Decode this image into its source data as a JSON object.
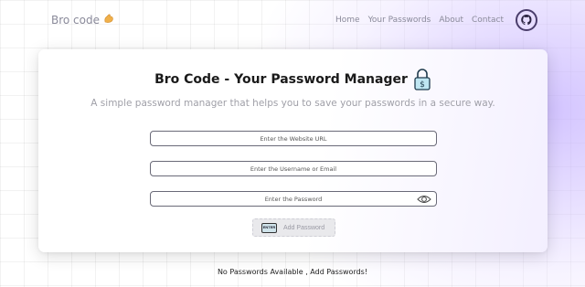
{
  "nav": {
    "brand": "Bro code",
    "brand_icon": "flexed-arm-emoji",
    "links": [
      "Home",
      "Your Passwords",
      "About",
      "Contact"
    ],
    "github_icon": "github-icon"
  },
  "card": {
    "title": "Bro Code - Your Password Manager",
    "title_icon": "lock-dollar-icon",
    "subtitle": "A simple password manager that helps you to save your passwords in a secure way.",
    "website_placeholder": "Enter the Website URL",
    "username_placeholder": "Enter the Username or Email",
    "password_placeholder": "Enter the Password",
    "add_button_label": "Add Password",
    "add_button_icon_text": "ENTER"
  },
  "empty_message": "No Passwords Available , Add Passwords!",
  "colors": {
    "accent_tint": "#c4b0ff",
    "text_muted": "#8a8a9a",
    "field_border": "#6a6a78"
  }
}
